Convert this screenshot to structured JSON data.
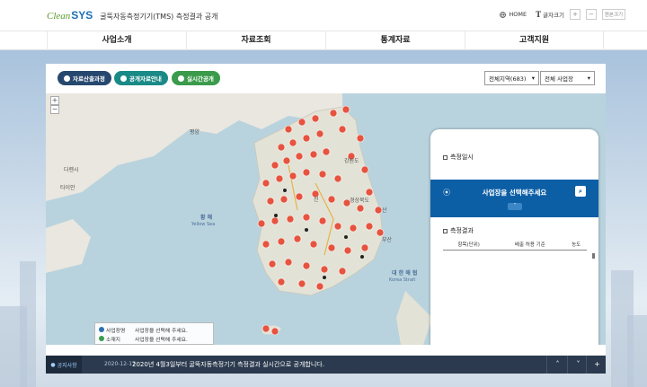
{
  "header": {
    "logo_clean": "Clean",
    "logo_sys": "SYS",
    "site_title": "굴뚝자동측정기기(TMS) 측정결과 공개",
    "home_label": "HOME",
    "font_size_label": "글자크기",
    "font_size_glyph": "T",
    "plus_label": "+",
    "minus_label": "−",
    "reset_label": "원본크기"
  },
  "nav": [
    "사업소개",
    "자료조회",
    "통계자료",
    "고객지원"
  ],
  "toolbar": {
    "btn_process": "자료산출과정",
    "btn_info": "공개자료안내",
    "btn_realtime": "실시간공개",
    "region_select": "전체지역(683)",
    "site_select": "전체 사업장"
  },
  "map": {
    "zoom_in": "+",
    "zoom_out": "−",
    "labels": {
      "yellow_sea_ko": "황 해",
      "yellow_sea_en": "Yellow Sea",
      "korea_strait_ko": "대 한 해 협",
      "korea_strait_en": "Korea Strait",
      "gangwon": "강원도",
      "busan": "부산",
      "gyeongbuk": "경상북도",
      "pyeongyang": "평양",
      "dalian": "다롄시",
      "taian": "타이안",
      "jin": "진",
      "san": "산"
    },
    "legend": [
      {
        "key": "사업장명",
        "value": "사업장을 선택해 주세요."
      },
      {
        "key": "소재지",
        "value": "사업장을 선택해 주세요."
      }
    ]
  },
  "side_panel": {
    "time_title": "측정일시",
    "select_prompt": "사업장을 선택해주세요",
    "result_title": "측정결과",
    "columns": [
      "항목(단위)",
      "배출 허용 기준",
      "농도"
    ]
  },
  "ticker": {
    "tag": "공지사항",
    "date": "2020-12-17",
    "message": "2020년 4월3일부터 굴뚝자동측정기기 측정결과 실시간으로 공개합니다.",
    "up": "˄",
    "down": "˅",
    "more": "+"
  },
  "colors": {
    "accent_blue": "#0d5fa5",
    "pill_navy": "#27486e",
    "pill_teal": "#1a8a86",
    "pill_green": "#3a9b4b",
    "marker": "#e6533f"
  }
}
